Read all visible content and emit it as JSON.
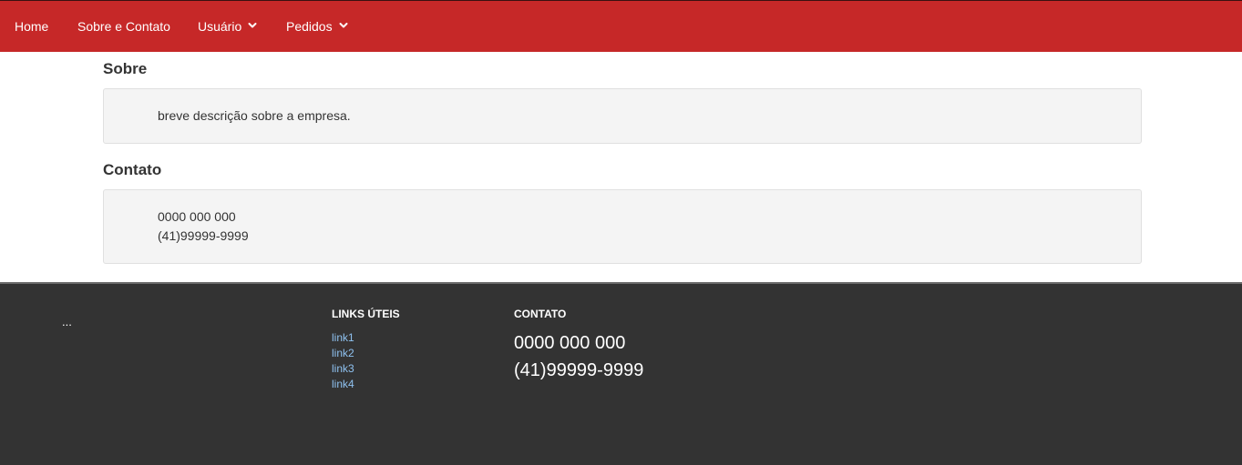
{
  "nav": {
    "home": "Home",
    "sobre_contato": "Sobre e Contato",
    "usuario": "Usuário",
    "pedidos": "Pedidos",
    "chevron_icon": "chevron-down-icon",
    "bg_color": "#c62828"
  },
  "main": {
    "sobre": {
      "title": "Sobre",
      "text": "breve descrição sobre a empresa."
    },
    "contato": {
      "title": "Contato",
      "phone1": "0000 000 000",
      "phone2": "(41)99999-9999"
    }
  },
  "footer": {
    "dots": "...",
    "links_heading": "LINKS ÚTEIS",
    "links": [
      "link1",
      "link2",
      "link3",
      "link4"
    ],
    "contact_heading": "CONTATO",
    "phone1": "0000 000 000",
    "phone2": "(41)99999-9999",
    "bg_color": "#333333"
  }
}
